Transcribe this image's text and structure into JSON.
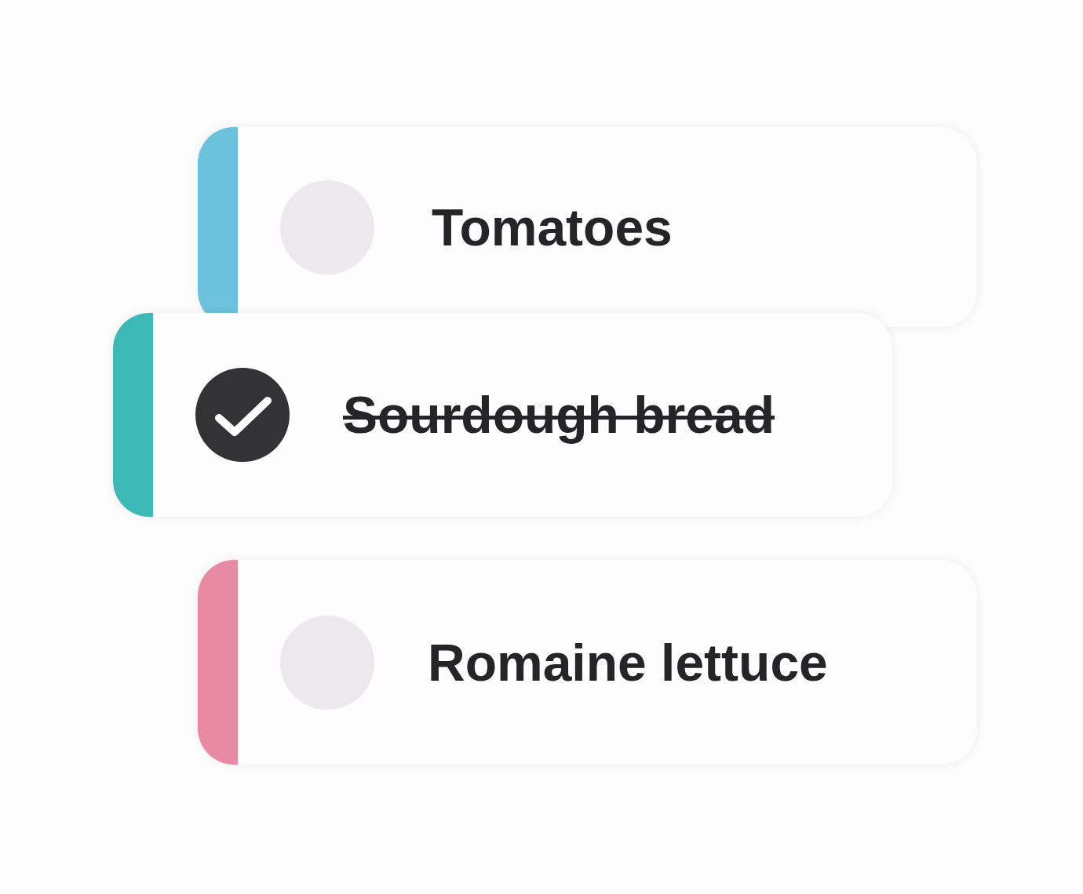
{
  "items": [
    {
      "label": "Tomatoes",
      "checked": false,
      "color": "#6cc2dd"
    },
    {
      "label": "Sourdough bread",
      "checked": true,
      "color": "#3cb9b6"
    },
    {
      "label": "Romaine lettuce",
      "checked": false,
      "color": "#e88aa3"
    }
  ]
}
